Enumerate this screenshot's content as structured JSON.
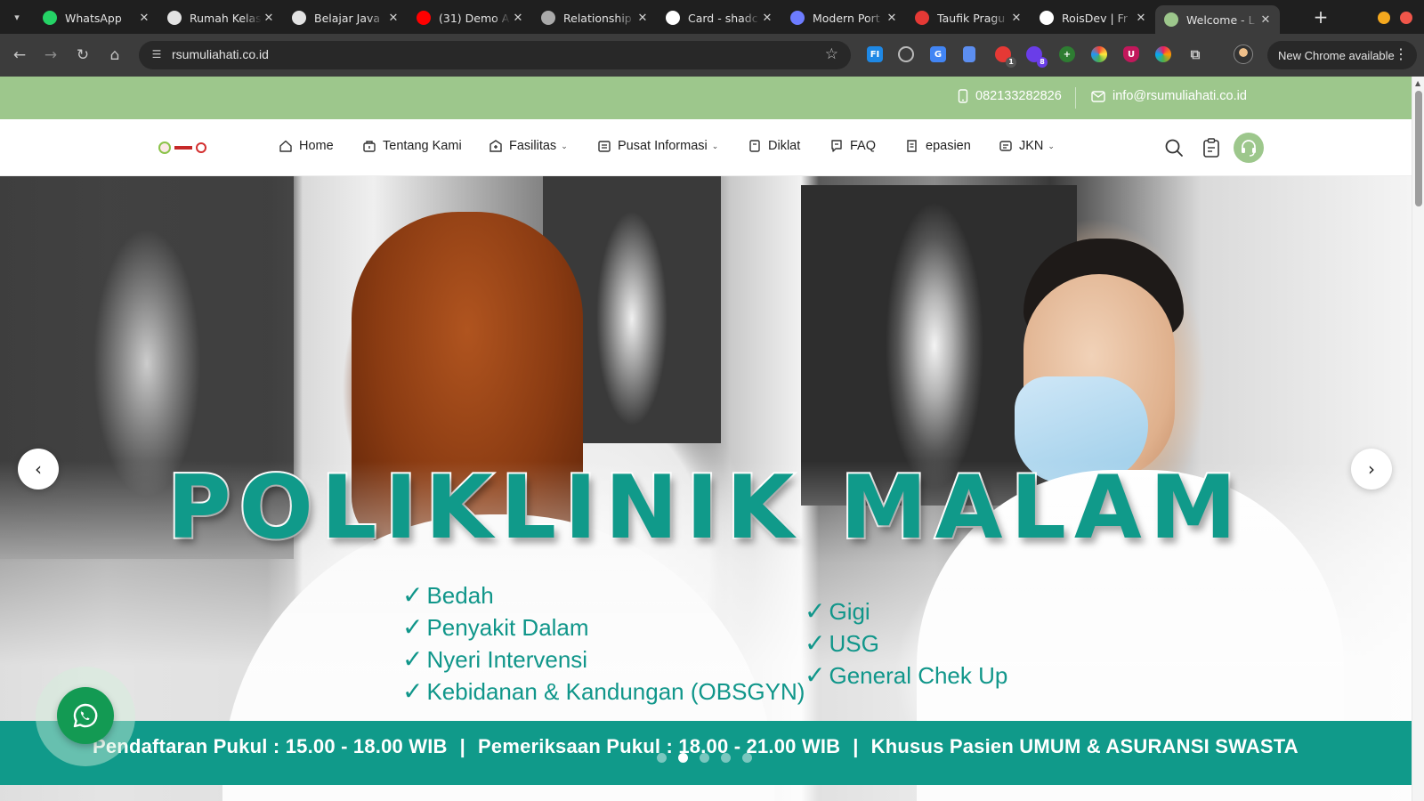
{
  "browser": {
    "tabs": [
      {
        "title": "WhatsApp",
        "icon": "whatsapp-icon",
        "color": "#25d366"
      },
      {
        "title": "Rumah Kelas",
        "icon": "openai-icon",
        "color": "#e3e3e3"
      },
      {
        "title": "Belajar Java",
        "icon": "github-icon",
        "color": "#e3e3e3"
      },
      {
        "title": "(31) Demo Ap",
        "icon": "youtube-icon",
        "color": "#ff0000"
      },
      {
        "title": "Relationship",
        "icon": "globe-icon",
        "color": "#aaaaaa"
      },
      {
        "title": "Card - shadc",
        "icon": "shadcn-icon",
        "color": "#ffffff"
      },
      {
        "title": "Modern Port",
        "icon": "bird-icon",
        "color": "#6d7cff"
      },
      {
        "title": "Taufik Pragu",
        "icon": "p-logo-icon",
        "color": "#e53935"
      },
      {
        "title": "RoisDev | Fr",
        "icon": "triangle-icon",
        "color": "#ffffff"
      },
      {
        "title": "Welcome - L",
        "icon": "hospital-favicon-icon",
        "color": "#9dc78c",
        "active": true
      }
    ],
    "url": "rsumuliahati.co.id",
    "update_label": "New Chrome available"
  },
  "topbar": {
    "phone": "082133282826",
    "email": "info@rsumuliahati.co.id"
  },
  "nav": {
    "items": [
      {
        "label": "Home",
        "icon": "home-icon"
      },
      {
        "label": "Tentang Kami",
        "icon": "building-icon"
      },
      {
        "label": "Fasilitas",
        "icon": "hospital-icon",
        "dropdown": true
      },
      {
        "label": "Pusat Informasi",
        "icon": "newspaper-icon",
        "dropdown": true
      },
      {
        "label": "Diklat",
        "icon": "book-icon"
      },
      {
        "label": "FAQ",
        "icon": "faq-icon"
      },
      {
        "label": "epasien",
        "icon": "patient-icon"
      },
      {
        "label": "JKN",
        "icon": "card-icon",
        "dropdown": true
      }
    ]
  },
  "hero": {
    "title": "POLIKLINIK MALAM",
    "services_left": [
      "Bedah",
      "Penyakit Dalam",
      "Nyeri Intervensi",
      "Kebidanan & Kandungan (OBSGYN)"
    ],
    "services_right": [
      "Gigi",
      "USG",
      "General Chek Up"
    ],
    "check_mark": "✓",
    "banner_parts": [
      "Pendaftaran Pukul : 15.00 - 18.00 WIB",
      "Pemeriksaan Pukul : 18.00 - 21.00 WIB",
      "Khusus Pasien UMUM & ASURANSI SWASTA"
    ],
    "banner_sep": "|",
    "slide_count": 5,
    "active_slide": 2
  },
  "colors": {
    "brand_green": "#9dc78c",
    "teal": "#109a8a",
    "whatsapp": "#139a53"
  }
}
